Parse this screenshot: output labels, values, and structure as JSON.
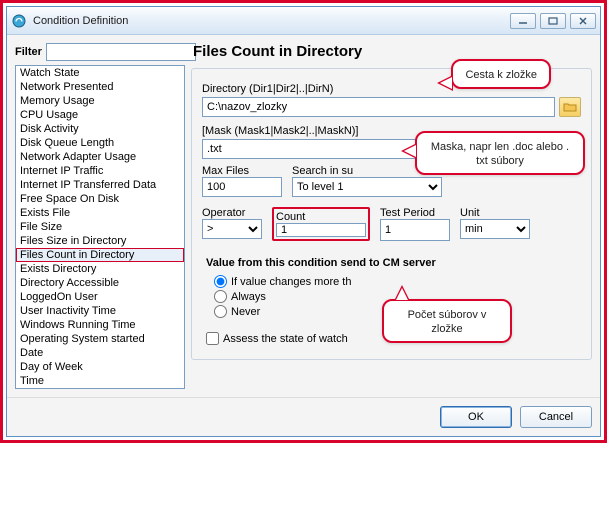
{
  "window": {
    "title": "Condition Definition",
    "buttons": {
      "ok": "OK",
      "cancel": "Cancel"
    }
  },
  "filter": {
    "label": "Filter",
    "value": ""
  },
  "sidebar": {
    "items": [
      "Watch State",
      "Network Presented",
      "Memory Usage",
      "CPU Usage",
      "Disk Activity",
      "Disk Queue Length",
      "Network Adapter Usage",
      "Internet IP Traffic",
      "Internet IP Transferred Data",
      "Free Space On Disk",
      "Exists File",
      "File Size",
      "Files Size in Directory",
      "Files Count in Directory",
      "Exists Directory",
      "Directory Accessible",
      "LoggedOn User",
      "User Inactivity Time",
      "Windows Running Time",
      "Operating System started",
      "Date",
      "Day of Week",
      "Time"
    ],
    "selected_index": 13
  },
  "panel": {
    "title": "Files Count in Directory",
    "directory_label": "Directory (Dir1|Dir2|..|DirN)",
    "directory_value": "C:\\nazov_zlozky",
    "mask_label": "[Mask (Mask1|Mask2|..|MaskN)]",
    "mask_value": ".txt",
    "maxfiles_label": "Max Files",
    "maxfiles_value": "100",
    "search_label": "Search in su",
    "search_value": "To level 1",
    "operator_label": "Operator",
    "operator_value": ">",
    "count_label": "Count",
    "count_value": "1",
    "testperiod_label": "Test Period",
    "testperiod_value": "1",
    "unit_label": "Unit",
    "unit_value": "min",
    "value_heading": "Value from this condition send to CM server",
    "radio_ifchange": "If value changes more th",
    "radio_always": "Always",
    "radio_never": "Never",
    "assess_label": "Assess the state of watch"
  },
  "callouts": {
    "c1": "Cesta k zložke",
    "c2": "Maska, napr len .doc alebo . txt súbory",
    "c3": "Počet súborov v zložke"
  }
}
